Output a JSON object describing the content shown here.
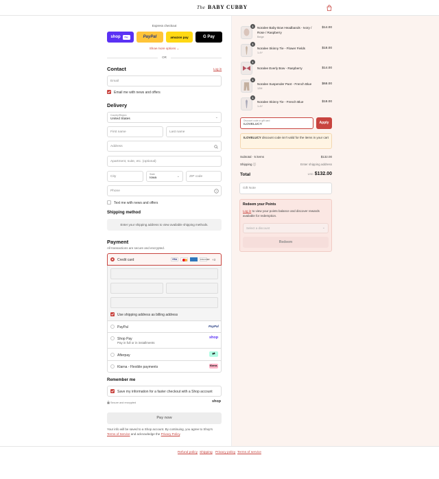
{
  "header": {
    "logo_prefix": "The",
    "logo_name": "BABY CUBBY"
  },
  "express": {
    "title": "Express checkout",
    "shop_pay": "shop",
    "shop_pay_chip": "Pay",
    "paypal": "PayPal",
    "amazon": "amazon pay",
    "gpay": "G Pay",
    "more": "Show more options",
    "or": "OR"
  },
  "contact": {
    "title": "Contact",
    "login": "Log in",
    "email_placeholder": "Email",
    "news": "Email me with news and offers"
  },
  "delivery": {
    "title": "Delivery",
    "country_label": "Country/Region",
    "country": "United States",
    "first": "First name",
    "last": "Last name",
    "address": "Address",
    "apt": "Apartment, suite, etc. (optional)",
    "city": "City",
    "state_label": "State",
    "state": "Iowa",
    "zip": "ZIP code",
    "phone": "Phone",
    "text_news": "Text me with news and offers"
  },
  "shipping": {
    "title": "Shipping method",
    "message": "Enter your shipping address to view available shipping methods."
  },
  "payment": {
    "title": "Payment",
    "subtitle": "All transactions are secure and encrypted.",
    "credit": "Credit card",
    "card_more": "+3",
    "billing": "Use shipping address as billing address",
    "paypal": "PayPal",
    "paypal_logo": "PayPal",
    "shoppay": "Shop Pay",
    "shoppay_sub": "Pay in full or in installments",
    "shoppay_logo": "shop",
    "afterpay": "Afterpay",
    "klarna": "Klarna - Flexible payments",
    "klarna_logo": "Klarna."
  },
  "remember": {
    "title": "Remember me",
    "save": "Save my information for a faster checkout with a Shop account",
    "secure": "Secure and encrypted",
    "shop": "shop"
  },
  "pay": {
    "button": "Pay now",
    "legal_1": "Your info will be saved to a Shop account. By continuing, you agree to Shop's",
    "tos": "Terms of Service",
    "legal_2": "and acknowledge the",
    "privacy": "Privacy Policy",
    "period": "."
  },
  "items": [
    {
      "qty": "1",
      "name": "Noralee Baby Bow Headbands - Ivory / Rose / Raspberry",
      "sub": "Beige",
      "price": "$14.00"
    },
    {
      "qty": "1",
      "name": "Noralee Skinny Tie - Flower Fields",
      "sub": "1-4Y",
      "price": "$18.00"
    },
    {
      "qty": "1",
      "name": "Noralee Everly Bow - Raspberry",
      "sub": "",
      "price": "$14.00"
    },
    {
      "qty": "1",
      "name": "Noralee Suspender Pant - French Blue",
      "sub": "12M",
      "price": "$68.00"
    },
    {
      "qty": "1",
      "name": "Noralee Skinny Tie - French Blue",
      "sub": "1-4Y",
      "price": "$18.00"
    }
  ],
  "discount": {
    "label": "Discount code or gift card",
    "value": "ILOVELUCY",
    "apply": "Apply",
    "error_code": "ILOVELUCY",
    "error_text": "discount code isn't valid for the items in your cart"
  },
  "summary": {
    "subtotal_label": "Subtotal · 5 items",
    "subtotal": "$132.00",
    "shipping_label": "Shipping",
    "shipping": "Enter shipping address",
    "total_label": "Total",
    "currency": "USD",
    "total": "$132.00"
  },
  "gift": {
    "placeholder": "Gift Note"
  },
  "redeem": {
    "title": "Redeem your Points",
    "login": "Log in",
    "text": "to view your points balance and discover rewards available for redemption.",
    "select": "Select a discount",
    "button": "Redeem"
  },
  "footer": {
    "refund": "Refund policy",
    "shipping": "Shipping",
    "privacy": "Privacy policy",
    "terms": "Terms of service"
  },
  "colors": {
    "accent": "#c8443f",
    "shop_pay": "#5a31f4",
    "paypal": "#ffc439",
    "amazon": "#ffd814",
    "right_bg": "#fcf3ef"
  }
}
